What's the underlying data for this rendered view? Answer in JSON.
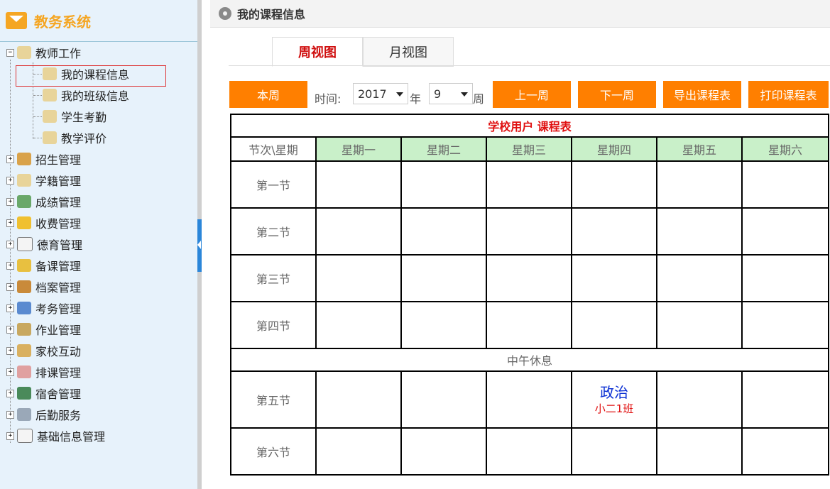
{
  "sidebar": {
    "app_title": "教务系统",
    "root": {
      "label": "教师工作",
      "expanded": true
    },
    "children": [
      {
        "label": "我的课程信息",
        "selected": true
      },
      {
        "label": "我的班级信息"
      },
      {
        "label": "学生考勤"
      },
      {
        "label": "教学评价"
      }
    ],
    "modules": [
      {
        "label": "招生管理"
      },
      {
        "label": "学籍管理"
      },
      {
        "label": "成绩管理"
      },
      {
        "label": "收费管理"
      },
      {
        "label": "德育管理"
      },
      {
        "label": "备课管理"
      },
      {
        "label": "档案管理"
      },
      {
        "label": "考务管理"
      },
      {
        "label": "作业管理"
      },
      {
        "label": "家校互动"
      },
      {
        "label": "排课管理"
      },
      {
        "label": "宿舍管理"
      },
      {
        "label": "后勤服务"
      },
      {
        "label": "基础信息管理"
      }
    ]
  },
  "header": {
    "title": "我的课程信息"
  },
  "tabs": [
    {
      "label": "周视图",
      "active": true
    },
    {
      "label": "月视图",
      "active": false
    }
  ],
  "toolbar": {
    "this_week": "本周",
    "time_label": "时间:",
    "year": "2017",
    "year_unit": "年",
    "week": "9",
    "week_unit": "周",
    "prev_week": "上一周",
    "next_week": "下一周",
    "export": "导出课程表",
    "print": "打印课程表"
  },
  "timetable": {
    "caption": "学校用户  课程表",
    "corner": "节次\\星期",
    "days": [
      "星期一",
      "星期二",
      "星期三",
      "星期四",
      "星期五",
      "星期六"
    ],
    "periods": [
      "第一节",
      "第二节",
      "第三节",
      "第四节"
    ],
    "noon": "中午休息",
    "afternoon": [
      "第五节",
      "第六节"
    ],
    "course": {
      "name": "政治",
      "class": "小二1班"
    }
  },
  "colors": {
    "accent": "#ff7f00",
    "active_tab": "#d01010",
    "day_header": "#c9f0c9",
    "course_name": "#0a2fd4",
    "course_class": "#e01010"
  }
}
